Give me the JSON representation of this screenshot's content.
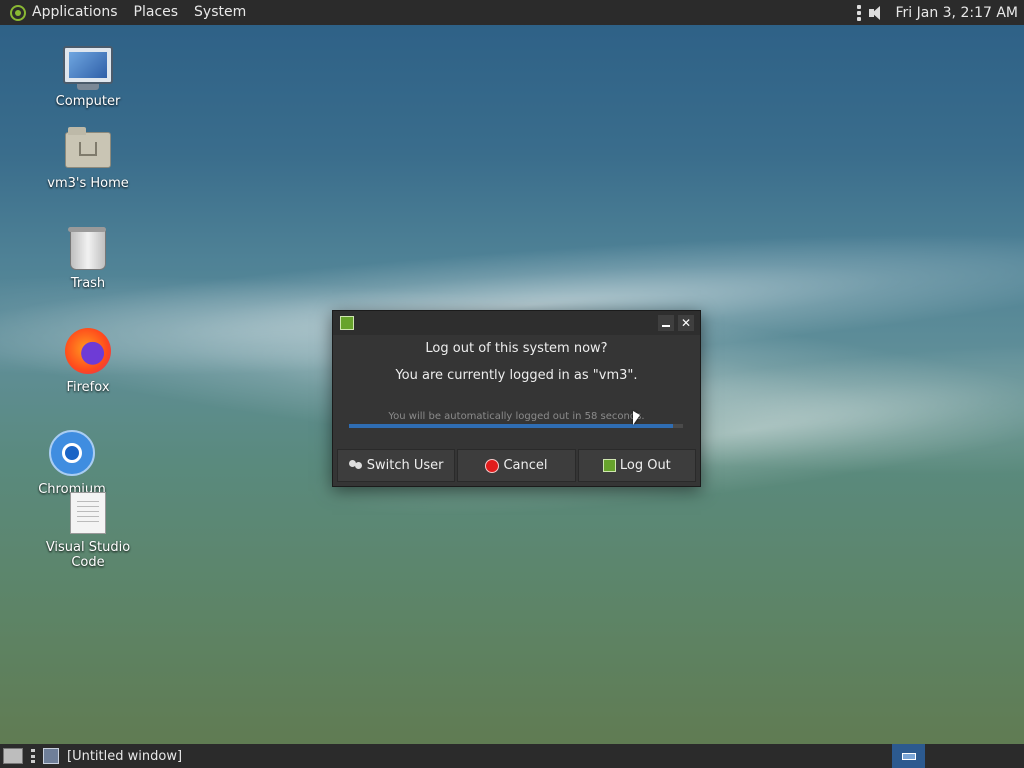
{
  "top_panel": {
    "menus": [
      "Applications",
      "Places",
      "System"
    ],
    "clock": "Fri Jan  3,  2:17 AM"
  },
  "desktop_icons": [
    {
      "label": "Computer",
      "icon": "computer-icon"
    },
    {
      "label": "vm3's Home",
      "icon": "home-folder-icon"
    },
    {
      "label": "Trash",
      "icon": "trash-icon"
    },
    {
      "label": "Firefox",
      "icon": "firefox-icon"
    },
    {
      "label": "Chromium",
      "icon": "chromium-icon"
    },
    {
      "label": "Visual Studio Code",
      "icon": "document-icon"
    }
  ],
  "dialog": {
    "question": "Log out of this system now?",
    "user_line": "You are currently logged in as \"vm3\".",
    "auto_logout": "You will be automatically logged out in 58 seconds.",
    "progress": 0.97,
    "buttons": {
      "switch_user": "Switch User",
      "cancel": "Cancel",
      "log_out": "Log Out"
    }
  },
  "bottom_panel": {
    "task_label": "[Untitled window]"
  },
  "colors": {
    "panel": "#2b2b2b",
    "dialog": "#353535",
    "progress": "#2f6db3",
    "cancel_red": "#e21c1c",
    "mate_green": "#67a32c"
  }
}
